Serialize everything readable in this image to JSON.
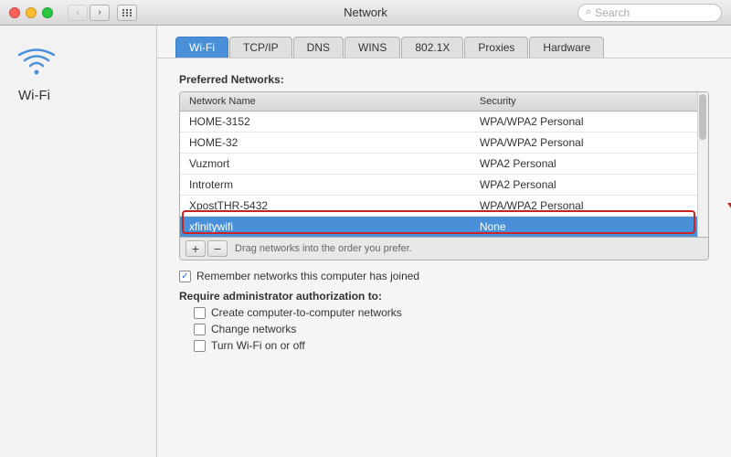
{
  "titlebar": {
    "title": "Network",
    "search_placeholder": "Search"
  },
  "sidebar": {
    "wifi_label": "Wi-Fi"
  },
  "tabs": [
    {
      "label": "Wi-Fi",
      "active": true
    },
    {
      "label": "TCP/IP",
      "active": false
    },
    {
      "label": "DNS",
      "active": false
    },
    {
      "label": "WINS",
      "active": false
    },
    {
      "label": "802.1X",
      "active": false
    },
    {
      "label": "Proxies",
      "active": false
    },
    {
      "label": "Hardware",
      "active": false
    }
  ],
  "preferred_networks": {
    "label": "Preferred Networks:",
    "columns": [
      "Network Name",
      "Security"
    ],
    "rows": [
      {
        "name": "HOME-3152",
        "security": "WPA/WPA2 Personal",
        "selected": false
      },
      {
        "name": "HOME-32",
        "security": "WPA/WPA2 Personal",
        "selected": false
      },
      {
        "name": "Vuzmort",
        "security": "WPA2 Personal",
        "selected": false
      },
      {
        "name": "Introterm",
        "security": "WPA2 Personal",
        "selected": false
      },
      {
        "name": "XpostTHR-5432",
        "security": "WPA/WPA2 Personal",
        "selected": false
      },
      {
        "name": "xfinitywifi",
        "security": "None",
        "selected": true
      }
    ],
    "drag_hint": "Drag networks into the order you prefer.",
    "add_label": "+",
    "remove_label": "−"
  },
  "options": {
    "remember_label": "Remember networks this computer has joined",
    "remember_checked": true,
    "admin_label": "Require administrator authorization to:",
    "admin_options": [
      {
        "label": "Create computer-to-computer networks",
        "checked": false
      },
      {
        "label": "Change networks",
        "checked": false
      },
      {
        "label": "Turn Wi-Fi on or off",
        "checked": false
      }
    ]
  }
}
